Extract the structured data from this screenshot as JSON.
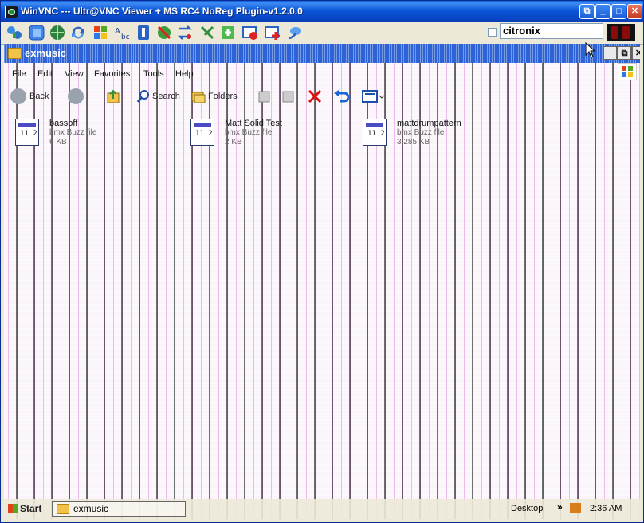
{
  "vnc": {
    "title": "WinVNC --- Ultr@VNC Viewer + MS RC4 NoReg Plugin-v1.2.0.0",
    "toolbar_icons": [
      "connect-options-icon",
      "fullscreen-icon",
      "network-icon",
      "refresh-icon",
      "windows-logo-icon",
      "send-ctrl-alt-del-icon",
      "info-icon",
      "no-input-icon",
      "transfer-icon",
      "chat-icon",
      "file-transfer-icon",
      "select-window-icon",
      "single-window-icon",
      "connection-icon"
    ],
    "host": "citronix"
  },
  "explorer": {
    "title": "exmusic",
    "menu": [
      "File",
      "Edit",
      "View",
      "Favorites",
      "Tools",
      "Help"
    ],
    "toolbar": {
      "back": "Back",
      "search": "Search",
      "folders": "Folders"
    },
    "files": [
      {
        "name": "bassoff",
        "type": "bmx Buzz file",
        "size": "6 KB"
      },
      {
        "name": "Matt Solid Test",
        "type": "bmx Buzz file",
        "size": "2 KB"
      },
      {
        "name": "mattdrumpattern",
        "type": "bmx Buzz file",
        "size": "3,285 KB"
      }
    ]
  },
  "taskbar": {
    "start": "Start",
    "task": "exmusic",
    "desktop": "Desktop",
    "chevron": "»",
    "clock": "2:36 AM"
  }
}
